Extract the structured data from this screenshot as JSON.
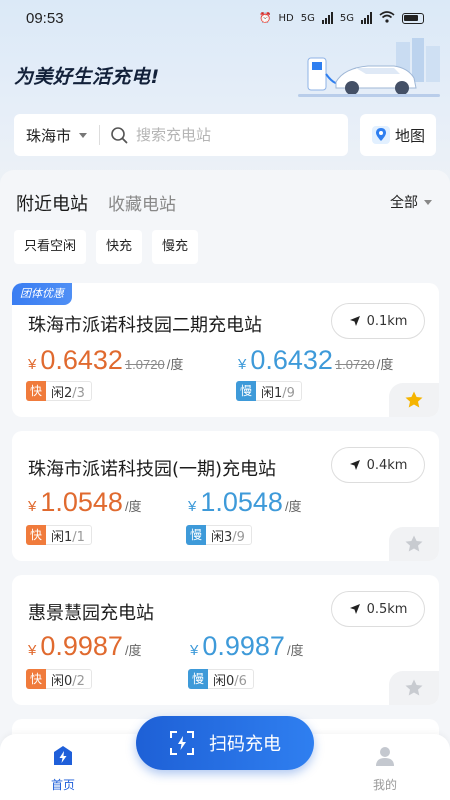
{
  "status": {
    "time": "09:53",
    "net1": "HD",
    "net2": "5G",
    "net3": "5G"
  },
  "header": {
    "slogan": "为美好生活充电!"
  },
  "search": {
    "city": "珠海市",
    "placeholder": "搜索充电站",
    "map_label": "地图"
  },
  "tabs": {
    "nearby": "附近电站",
    "favorites": "收藏电站",
    "filter": "全部"
  },
  "chips": [
    "只看空闲",
    "快充",
    "慢充"
  ],
  "stations": [
    {
      "tag": "团体优惠",
      "name": "珠海市派诺科技园二期充电站",
      "distance": "0.1km",
      "fast": {
        "currency": "¥",
        "price": "0.6432",
        "old_price": "1.0720",
        "unit": "/度",
        "badge": "快",
        "free_label": "闲",
        "free": "2",
        "total": "/3"
      },
      "slow": {
        "currency": "¥",
        "price": "0.6432",
        "old_price": "1.0720",
        "unit": "/度",
        "badge": "慢",
        "free_label": "闲",
        "free": "1",
        "total": "/9"
      },
      "favorited": true
    },
    {
      "tag": "",
      "name": "珠海市派诺科技园(一期)充电站",
      "distance": "0.4km",
      "fast": {
        "currency": "¥",
        "price": "1.0548",
        "unit": "/度",
        "badge": "快",
        "free_label": "闲",
        "free": "1",
        "total": "/1"
      },
      "slow": {
        "currency": "¥",
        "price": "1.0548",
        "unit": "/度",
        "badge": "慢",
        "free_label": "闲",
        "free": "3",
        "total": "/9"
      },
      "favorited": false
    },
    {
      "tag": "",
      "name": "惠景慧园充电站",
      "distance": "0.5km",
      "fast": {
        "currency": "¥",
        "price": "0.9987",
        "unit": "/度",
        "badge": "快",
        "free_label": "闲",
        "free": "0",
        "total": "/2"
      },
      "slow": {
        "currency": "¥",
        "price": "0.9987",
        "unit": "/度",
        "badge": "慢",
        "free_label": "闲",
        "free": "0",
        "total": "/6"
      },
      "favorited": false
    }
  ],
  "bottom": {
    "home": "首页",
    "scan": "扫码充电",
    "mine": "我的"
  },
  "colors": {
    "accent": "#1f5fd9",
    "fast": "#e06a2f",
    "slow": "#3e9ad9",
    "star": "#f5b400"
  },
  "icons": [
    "search-icon",
    "map-pin-icon",
    "navigate-arrow-icon",
    "star-icon",
    "scan-icon",
    "home-bolt-icon",
    "user-icon"
  ]
}
